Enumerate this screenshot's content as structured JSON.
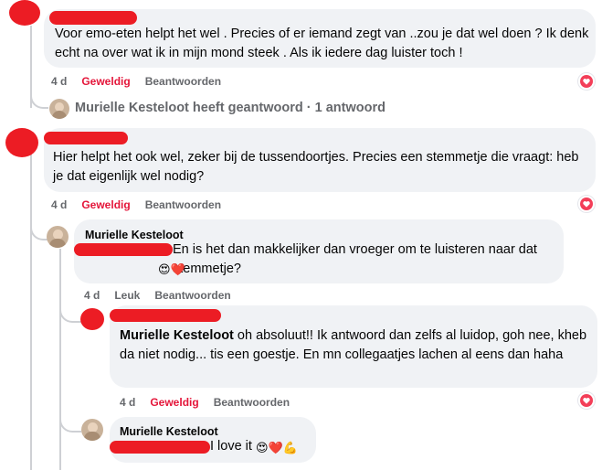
{
  "comments": [
    {
      "text": "Voor emo-eten helpt het wel . Precies of er iemand zegt van ..zou je dat wel doen ? Ik denk echt na over wat ik in mijn mond steek . Als ik iedere dag luister toch !",
      "time": "4 d",
      "like": "Geweldig",
      "reply": "Beantwoorden"
    },
    {
      "replies_summary": "Murielle Kesteloot heeft geantwoord · 1 antwoord"
    },
    {
      "text": "Hier helpt het ook wel, zeker bij de tussendoortjes. Precies een stemmetje die vraagt: heb je dat eigenlijk wel nodig?",
      "time": "4 d",
      "like": "Geweldig",
      "reply": "Beantwoorden"
    },
    {
      "author": "Murielle Kesteloot",
      "text": "En is het dan makkelijker dan vroeger om te luisteren naar dat stemmetje?",
      "emoji": "😍❤️",
      "time": "4 d",
      "like": "Leuk",
      "reply": "Beantwoorden"
    },
    {
      "mention": "Murielle Kesteloot",
      "text": " oh absoluut!! Ik antwoord dan zelfs al luidop, goh nee, kheb da niet nodig... tis een goestje. En mn collegaatjes lachen al eens dan haha",
      "time": "4 d",
      "like": "Geweldig",
      "reply": "Beantwoorden"
    },
    {
      "author": "Murielle Kesteloot",
      "text": "I love it",
      "emoji": "😍❤️💪"
    }
  ],
  "icons": {
    "heart": "heart-reaction-icon"
  },
  "colors": {
    "red": "#ec1c24",
    "like": "#e4163a",
    "bubble": "#f0f2f5",
    "meta": "#65676b"
  }
}
